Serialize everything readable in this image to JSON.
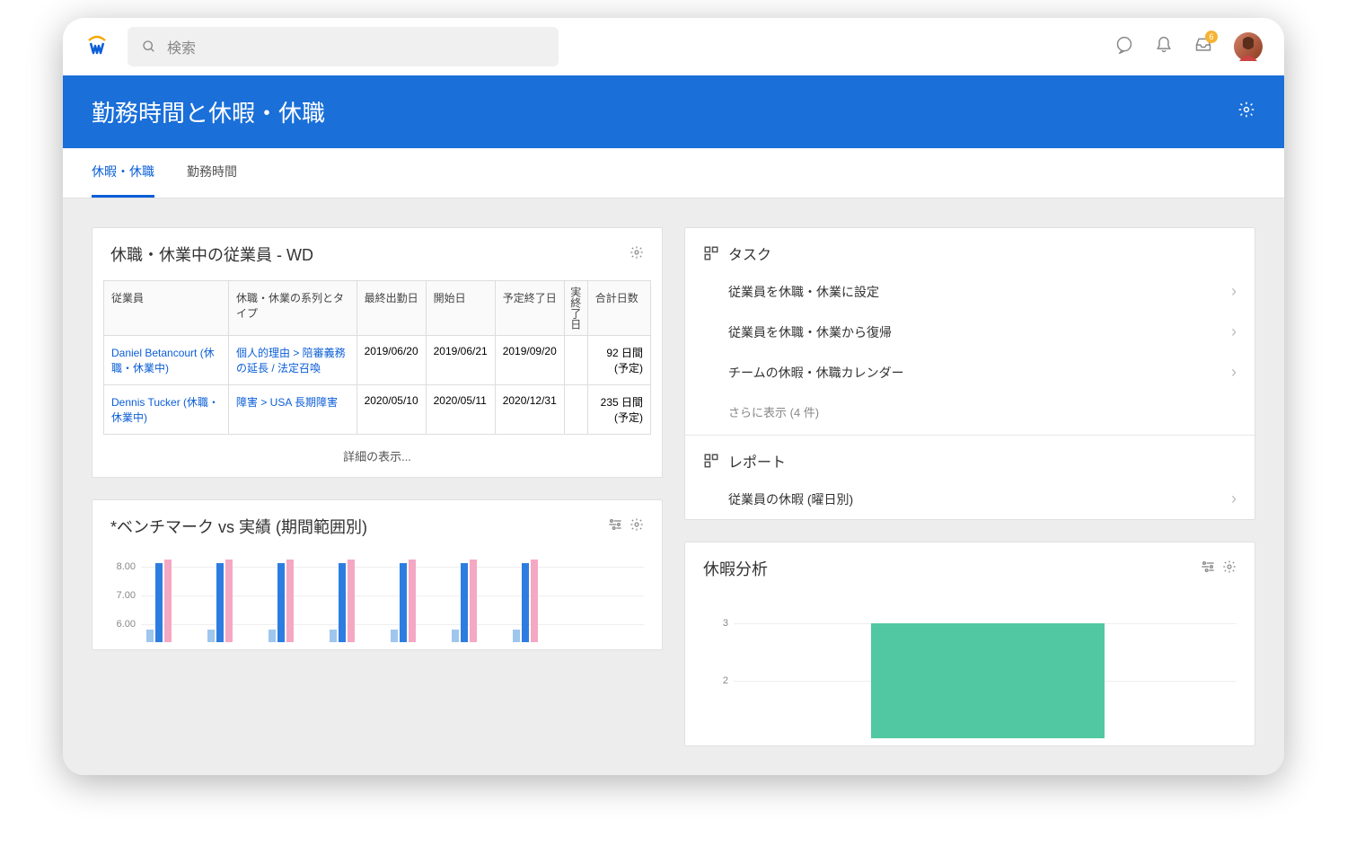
{
  "search": {
    "placeholder": "検索"
  },
  "header": {
    "title": "勤務時間と休暇・休職"
  },
  "tabs": [
    {
      "label": "休暇・休職",
      "active": true
    },
    {
      "label": "勤務時間",
      "active": false
    }
  ],
  "employees_card": {
    "title": "休職・休業中の従業員 - WD",
    "columns": {
      "employee": "従業員",
      "type": "休職・休業の系列とタイプ",
      "last_day": "最終出勤日",
      "start": "開始日",
      "planned_end": "予定終了日",
      "actual_end": "実終了日",
      "total_days": "合計日数"
    },
    "rows": [
      {
        "employee": "Daniel Betancourt (休職・休業中)",
        "type": "個人的理由 > 陪審義務の延長 / 法定召喚",
        "last_day": "2019/06/20",
        "start": "2019/06/21",
        "planned_end": "2019/09/20",
        "actual_end": "",
        "total": "92 日間 (予定)"
      },
      {
        "employee": "Dennis Tucker (休職・休業中)",
        "type": "障害 > USA 長期障害",
        "last_day": "2020/05/10",
        "start": "2020/05/11",
        "planned_end": "2020/12/31",
        "actual_end": "",
        "total": "235 日間 (予定)"
      }
    ],
    "view_more": "詳細の表示..."
  },
  "tasks": {
    "heading": "タスク",
    "items": [
      "従業員を休職・休業に設定",
      "従業員を休職・休業から復帰",
      "チームの休暇・休職カレンダー"
    ],
    "more": "さらに表示 (4 件)"
  },
  "reports": {
    "heading": "レポート",
    "items": [
      "従業員の休暇 (曜日別)"
    ]
  },
  "benchmark_card": {
    "title": "*ベンチマーク vs 実績 (期間範囲別)"
  },
  "analysis_card": {
    "title": "休暇分析"
  },
  "chart_data": [
    {
      "type": "bar",
      "title": "*ベンチマーク vs 実績 (期間範囲別)",
      "yticks": [
        8.0,
        7.0,
        6.0
      ],
      "ylim": [
        6.0,
        8.5
      ],
      "series": [
        {
          "name": "series1",
          "color": "#9fc6ed",
          "values": [
            6.3,
            6.3,
            6.3,
            6.3,
            6.3,
            6.3,
            6.3
          ]
        },
        {
          "name": "series2",
          "color": "#2d7de1",
          "values": [
            7.9,
            7.9,
            7.9,
            7.9,
            7.9,
            7.9,
            7.9
          ]
        },
        {
          "name": "series3",
          "color": "#f5a8c3",
          "values": [
            8.0,
            8.0,
            8.0,
            8.0,
            8.0,
            8.0,
            8.0
          ]
        }
      ]
    },
    {
      "type": "bar",
      "title": "休暇分析",
      "yticks": [
        3,
        2
      ],
      "ylim": [
        0,
        3
      ],
      "series": [
        {
          "name": "count",
          "color": "#51c8a1",
          "values": [
            2.6
          ]
        }
      ]
    }
  ]
}
